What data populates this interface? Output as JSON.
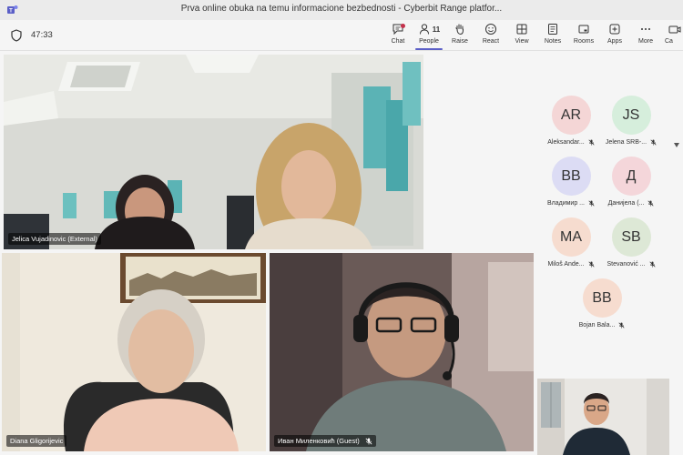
{
  "window": {
    "title": "Prva online obuka na temu informacione bezbednosti - Cyberbit Range platfor..."
  },
  "toolbar": {
    "timer": "47:33",
    "people_count": "11",
    "buttons": [
      {
        "label": "Chat",
        "icon": "chat-icon"
      },
      {
        "label": "People",
        "icon": "people-icon"
      },
      {
        "label": "Raise",
        "icon": "raise-hand-icon"
      },
      {
        "label": "React",
        "icon": "react-icon"
      },
      {
        "label": "View",
        "icon": "view-icon"
      },
      {
        "label": "Notes",
        "icon": "notes-icon"
      },
      {
        "label": "Rooms",
        "icon": "rooms-icon"
      },
      {
        "label": "Apps",
        "icon": "apps-icon"
      },
      {
        "label": "More",
        "icon": "more-icon"
      },
      {
        "label": "Ca",
        "icon": "camera-icon"
      }
    ]
  },
  "tiles": [
    {
      "name": "Jelica Vujadinovic (External)"
    },
    {
      "name": "Diana Gligorijevic"
    },
    {
      "name": "Иван Миленковић (Guest)"
    }
  ],
  "roster": [
    {
      "initials": "AR",
      "name": "Aleksandar...",
      "color": "#f4d6d6"
    },
    {
      "initials": "JS",
      "name": "Jelena SRB-...",
      "color": "#d6eedc"
    },
    {
      "initials": "BB",
      "name": "Владимир ...",
      "color": "#dcdcf4"
    },
    {
      "initials": "Д",
      "name": "Данијела (...",
      "color": "#f4d6da"
    },
    {
      "initials": "MA",
      "name": "Miloš Ande...",
      "color": "#f6dccf"
    },
    {
      "initials": "SB",
      "name": "Stevanović ...",
      "color": "#dde8d6"
    },
    {
      "initials": "BB",
      "name": "Bojan Bala...",
      "color": "#f6dccf"
    }
  ],
  "colors": {
    "accent": "#5b5fc7",
    "notify": "#c4314b"
  }
}
